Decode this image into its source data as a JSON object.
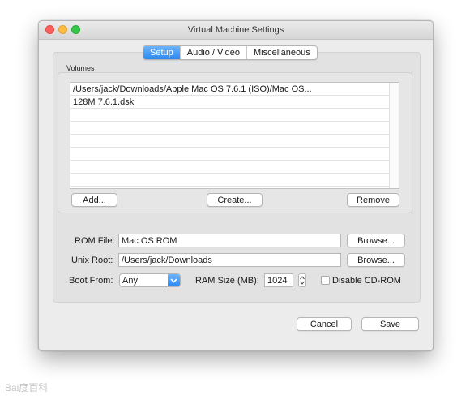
{
  "window": {
    "title": "Virtual Machine Settings"
  },
  "tabs": [
    {
      "label": "Setup",
      "active": true
    },
    {
      "label": "Audio / Video",
      "active": false
    },
    {
      "label": "Miscellaneous",
      "active": false
    }
  ],
  "volumes": {
    "label": "Volumes",
    "items": [
      "/Users/jack/Downloads/Apple Mac OS 7.6.1 (ISO)/Mac OS...",
      "128M 7.6.1.dsk"
    ],
    "add_label": "Add...",
    "create_label": "Create...",
    "remove_label": "Remove"
  },
  "rom": {
    "label": "ROM File:",
    "value": "Mac OS ROM",
    "browse_label": "Browse..."
  },
  "unix_root": {
    "label": "Unix Root:",
    "value": "/Users/jack/Downloads",
    "browse_label": "Browse..."
  },
  "boot": {
    "label": "Boot From:",
    "value": "Any"
  },
  "ram": {
    "label": "RAM Size (MB):",
    "value": "1024"
  },
  "cdrom": {
    "label": "Disable CD-ROM",
    "checked": false
  },
  "footer": {
    "cancel_label": "Cancel",
    "save_label": "Save"
  },
  "watermark": {
    "text": "Bai度百科"
  },
  "colors": {
    "accent": "#2b89f2",
    "window_bg": "#ececec",
    "close": "#fc605c",
    "minimize": "#fdbc40",
    "maximize": "#34c84a"
  },
  "icons": {
    "boot_dropdown": "chevron-down-icon",
    "ram_stepper": "up-down-icon"
  }
}
